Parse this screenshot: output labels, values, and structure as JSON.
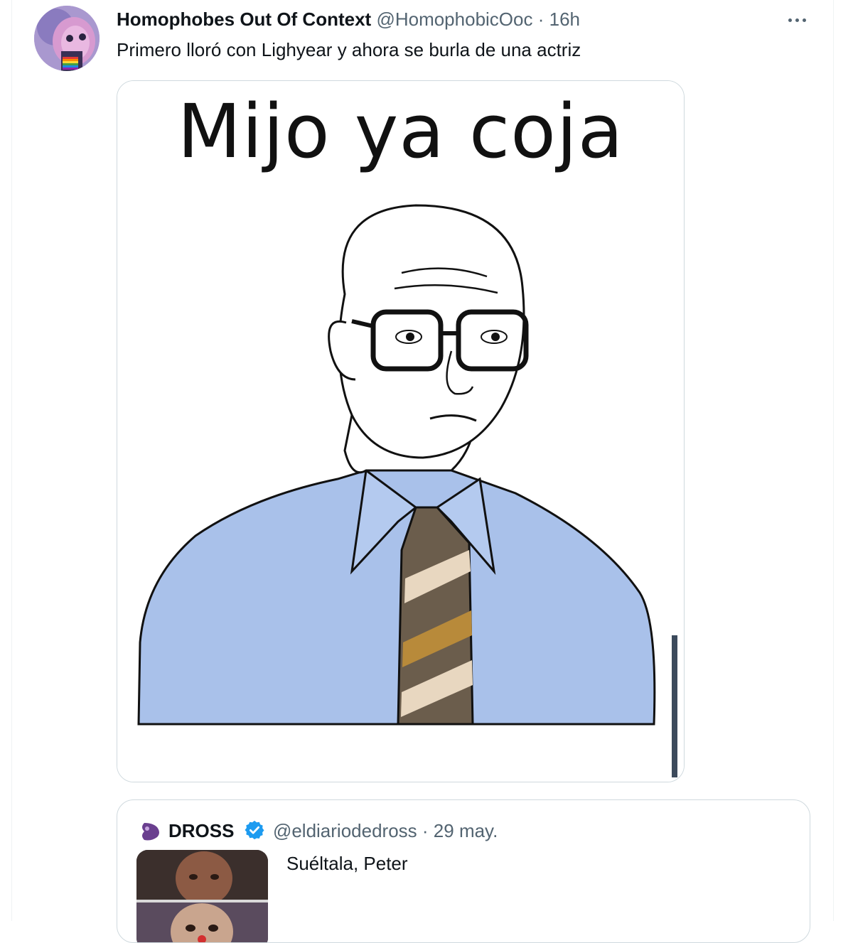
{
  "tweet": {
    "author_name": "Homophobes Out Of Context",
    "author_handle": "@HomophobicOoc",
    "separator": "·",
    "time": "16h",
    "text": "Primero lloró con Lighyear y ahora se burla de una actriz",
    "more_icon": "more-horizontal-icon",
    "media": {
      "caption": "Mijo ya coja"
    }
  },
  "quoted_tweet": {
    "author_name": "DROSS",
    "author_handle": "@eldiariodedross",
    "separator": "·",
    "date": "29 may.",
    "text": "Suéltala, Peter",
    "verified_icon": "verified-badge-icon",
    "verified_color": "#1d9bf0"
  },
  "colors": {
    "text_primary": "#0f1419",
    "text_secondary": "#536471",
    "border": "#cfd9de",
    "shirt_blue": "#a9c1ea"
  }
}
